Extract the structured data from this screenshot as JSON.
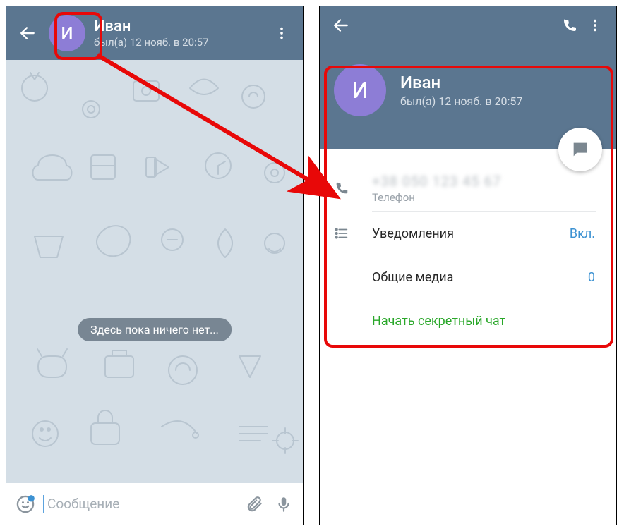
{
  "chat": {
    "name": "Иван",
    "status": "был(а) 12 нояб. в 20:57",
    "avatar_initial": "И",
    "empty_text": "Здесь пока ничего нет...",
    "input_placeholder": "Сообщение"
  },
  "profile": {
    "name": "Иван",
    "status": "был(а) 12 нояб. в 20:57",
    "avatar_initial": "И",
    "phone_label": "Телефон",
    "phone_masked": "+38 050 123 45 67",
    "rows": {
      "notifications": {
        "label": "Уведомления",
        "value": "Вкл."
      },
      "shared_media": {
        "label": "Общие медиа",
        "value": "0"
      },
      "secret_chat": {
        "label": "Начать секретный чат"
      }
    }
  }
}
